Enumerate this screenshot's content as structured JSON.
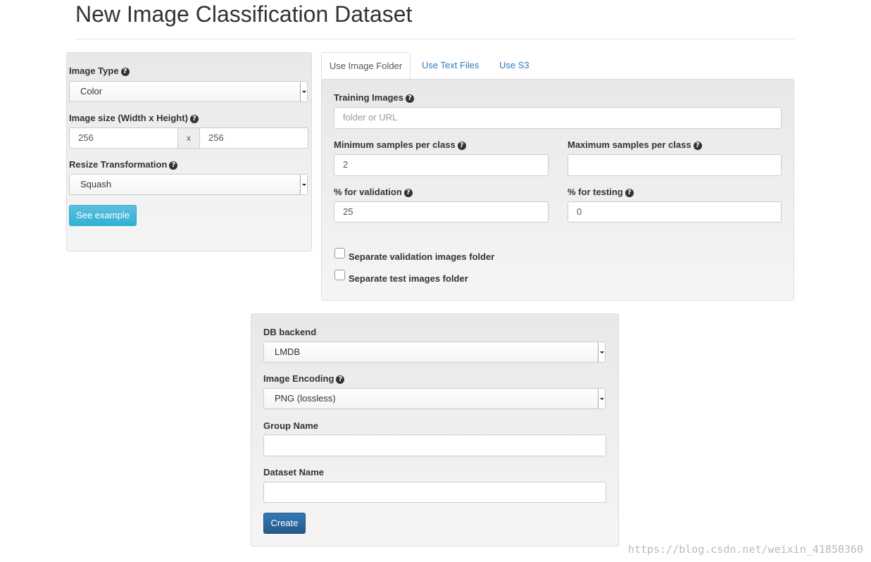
{
  "page": {
    "title": "New Image Classification Dataset"
  },
  "image_options": {
    "image_type_label": "Image Type",
    "image_type_value": "Color",
    "image_size_label": "Image size (Width x Height)",
    "width_value": "256",
    "size_separator": "x",
    "height_value": "256",
    "resize_label": "Resize Transformation",
    "resize_value": "Squash",
    "see_example_label": "See example"
  },
  "tabs": [
    {
      "label": "Use Image Folder",
      "active": true
    },
    {
      "label": "Use Text Files",
      "active": false
    },
    {
      "label": "Use S3",
      "active": false
    }
  ],
  "folder_panel": {
    "training_images_label": "Training Images",
    "training_images_placeholder": "folder or URL",
    "min_samples_label": "Minimum samples per class",
    "min_samples_value": "2",
    "max_samples_label": "Maximum samples per class",
    "max_samples_value": "",
    "validation_label": "% for validation",
    "validation_value": "25",
    "testing_label": "% for testing",
    "testing_value": "0",
    "separate_validation_label": "Separate validation images folder",
    "separate_test_label": "Separate test images folder"
  },
  "db_panel": {
    "db_backend_label": "DB backend",
    "db_backend_value": "LMDB",
    "image_encoding_label": "Image Encoding",
    "image_encoding_value": "PNG (lossless)",
    "group_name_label": "Group Name",
    "group_name_value": "",
    "dataset_name_label": "Dataset Name",
    "dataset_name_value": "",
    "create_label": "Create"
  },
  "watermark": "https://blog.csdn.net/weixin_41850360",
  "colors": {
    "link": "#337ab7",
    "primary_button": "#286090",
    "info_button": "#5bc0de"
  }
}
